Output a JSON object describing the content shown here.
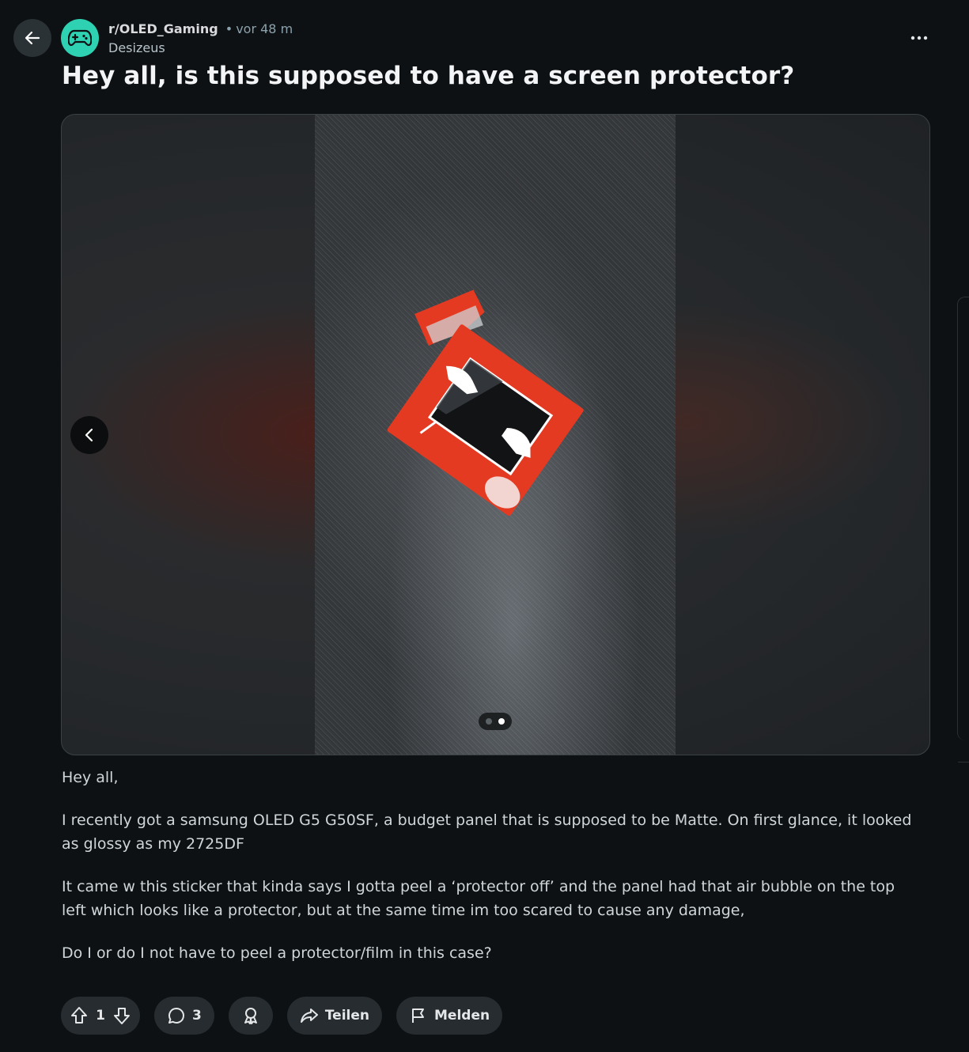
{
  "header": {
    "subreddit": "r/OLED_Gaming",
    "separator": "•",
    "time": "vor 48 m",
    "author": "Desizeus"
  },
  "post": {
    "title": "Hey all, is this supposed to have a screen protector?",
    "body": [
      "Hey all,",
      "I recently got a samsung OLED G5 G50SF, a budget panel that is supposed to be Matte. On first glance, it looked as glossy as my 2725DF",
      "It came w this sticker that kinda says I gotta peel a ‘protector off’ and the panel had that air bubble on the top left which looks like a protector, but at the same time im too scared to cause any damage,",
      "Do I or do I not have to peel a protector/film in this case?"
    ]
  },
  "gallery": {
    "image_count": 2,
    "active_index": 1
  },
  "actions": {
    "vote_count": "1",
    "comment_count": "3",
    "share_label": "Teilen",
    "report_label": "Melden"
  },
  "colors": {
    "background": "#0e1113",
    "subreddit_avatar": "#2ed1b1",
    "pill": "#262c2f",
    "sticker_red": "#e53a22"
  },
  "icons": [
    "back-arrow-icon",
    "gamepad-icon",
    "more-icon",
    "chevron-left-icon",
    "upvote-icon",
    "downvote-icon",
    "comment-icon",
    "award-icon",
    "share-icon",
    "flag-icon"
  ]
}
